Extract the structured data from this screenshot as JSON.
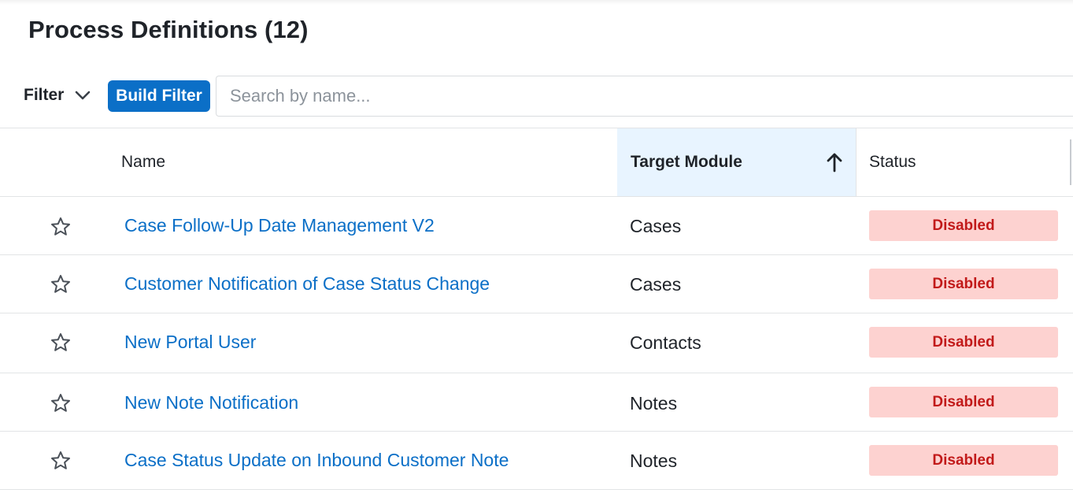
{
  "page": {
    "title": "Process Definitions",
    "count": "(12)"
  },
  "filter": {
    "label": "Filter",
    "build_filter_label": "Build Filter",
    "search_placeholder": "Search by name..."
  },
  "table": {
    "columns": {
      "name": "Name",
      "target_module": "Target Module",
      "status": "Status"
    },
    "sort": {
      "column": "Target Module",
      "direction": "ascending"
    },
    "rows": [
      {
        "name": "Case Follow-Up Date Management V2",
        "module": "Cases",
        "status": "Disabled"
      },
      {
        "name": "Customer Notification of Case Status Change",
        "module": "Cases",
        "status": "Disabled"
      },
      {
        "name": "New Portal User",
        "module": "Contacts",
        "status": "Disabled"
      },
      {
        "name": "New Note Notification",
        "module": "Notes",
        "status": "Disabled"
      },
      {
        "name": "Case Status Update on Inbound Customer Note",
        "module": "Notes",
        "status": "Disabled"
      }
    ]
  },
  "icons": {
    "favorite": "star-icon",
    "filter_toggle": "chevron-down-icon",
    "sort": "arrow-up-icon"
  },
  "colors": {
    "link": "#0b6fc7",
    "primary_button": "#0b6fc7",
    "sorted_header_bg": "#e8f4ff",
    "disabled_badge_bg": "#fdd2d0",
    "disabled_badge_text": "#c21a1a"
  }
}
